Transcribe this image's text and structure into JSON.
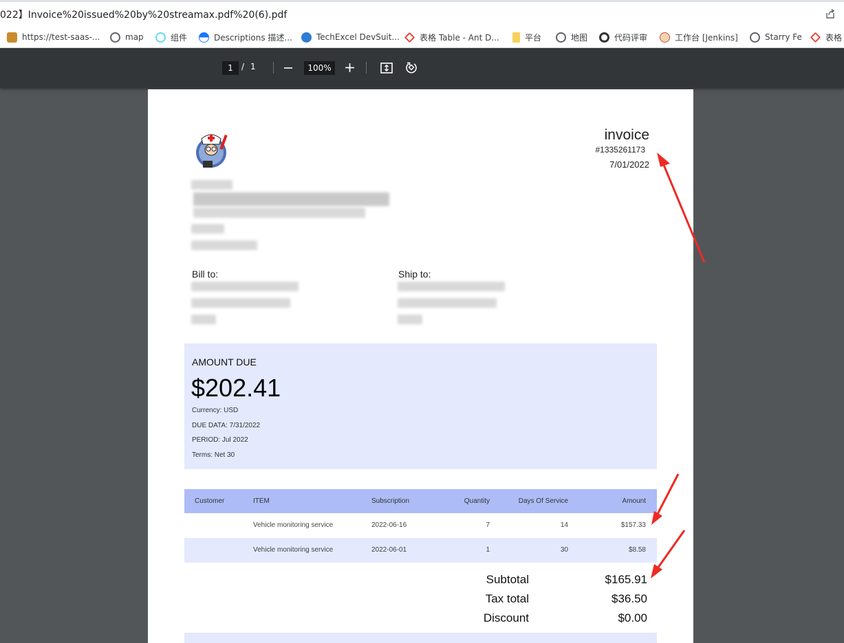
{
  "browser": {
    "url_title": "022】Invoice%20issued%20by%20streamax.pdf%20(6).pdf",
    "bookmarks": [
      {
        "label": "https://test-saas-...",
        "icon": "dog-avatar-icon",
        "color": "#c98b2b"
      },
      {
        "label": "map",
        "icon": "globe-icon",
        "color": "#5f6368"
      },
      {
        "label": "组件",
        "icon": "react-icon",
        "color": "#61dafb"
      },
      {
        "label": "Descriptions 描述...",
        "icon": "ant-design-icon",
        "color": "#1677ff"
      },
      {
        "label": "TechExcel DevSuit...",
        "icon": "techexcel-icon",
        "color": "#2d7dd2"
      },
      {
        "label": "表格 Table - Ant D...",
        "icon": "ant-diamond-icon",
        "color": "#e8463a"
      },
      {
        "label": "平台",
        "icon": "folder-icon",
        "color": "#f7d25c"
      },
      {
        "label": "地图",
        "icon": "globe-icon",
        "color": "#5f6368"
      },
      {
        "label": "代码评审",
        "icon": "gerrit-icon",
        "color": "#333333"
      },
      {
        "label": "工作台 [Jenkins]",
        "icon": "jenkins-icon",
        "color": "#d24939"
      },
      {
        "label": "Starry Fe",
        "icon": "globe-icon",
        "color": "#5f6368"
      },
      {
        "label": "表格",
        "icon": "ant-diamond-icon",
        "color": "#e8463a"
      }
    ]
  },
  "toolbar": {
    "current_page": "1",
    "separator": "/",
    "total_pages": "1",
    "zoom": "100%"
  },
  "invoice": {
    "title": "invoice",
    "number": "#1335261173",
    "date": "7/01/2022",
    "bill_to_label": "Bill to:",
    "ship_to_label": "Ship to:",
    "amount_due_label": "AMOUNT DUE",
    "amount_due": "$202.41",
    "currency": "Currency: USD",
    "due_date": "DUE DATA: 7/31/2022",
    "period": "PERIOD: Jul 2022",
    "terms": "Terms: Net 30",
    "table": {
      "headers": {
        "customer": "Customer",
        "item": "ITEM",
        "subscription": "Subscription",
        "quantity": "Quantity",
        "days": "Days Of Service",
        "amount": "Amount"
      },
      "rows": [
        {
          "customer": "",
          "item": "Vehicle monitoring service",
          "subscription": "2022-06-16",
          "quantity": "7",
          "days": "14",
          "amount": "$157.33"
        },
        {
          "customer": "",
          "item": "Vehicle monitoring service",
          "subscription": "2022-06-01",
          "quantity": "1",
          "days": "30",
          "amount": "$8.58"
        }
      ]
    },
    "totals": {
      "subtotal_label": "Subtotal",
      "subtotal": "$165.91",
      "tax_label": "Tax total",
      "tax": "$36.50",
      "discount_label": "Discount",
      "discount": "$0.00"
    }
  },
  "colors": {
    "toolbar_bg": "#323639",
    "viewer_bg": "#525659",
    "due_box_bg": "#e4e9fd",
    "table_header_bg": "#adbcf6",
    "annotation_arrow": "#ee2a24"
  }
}
